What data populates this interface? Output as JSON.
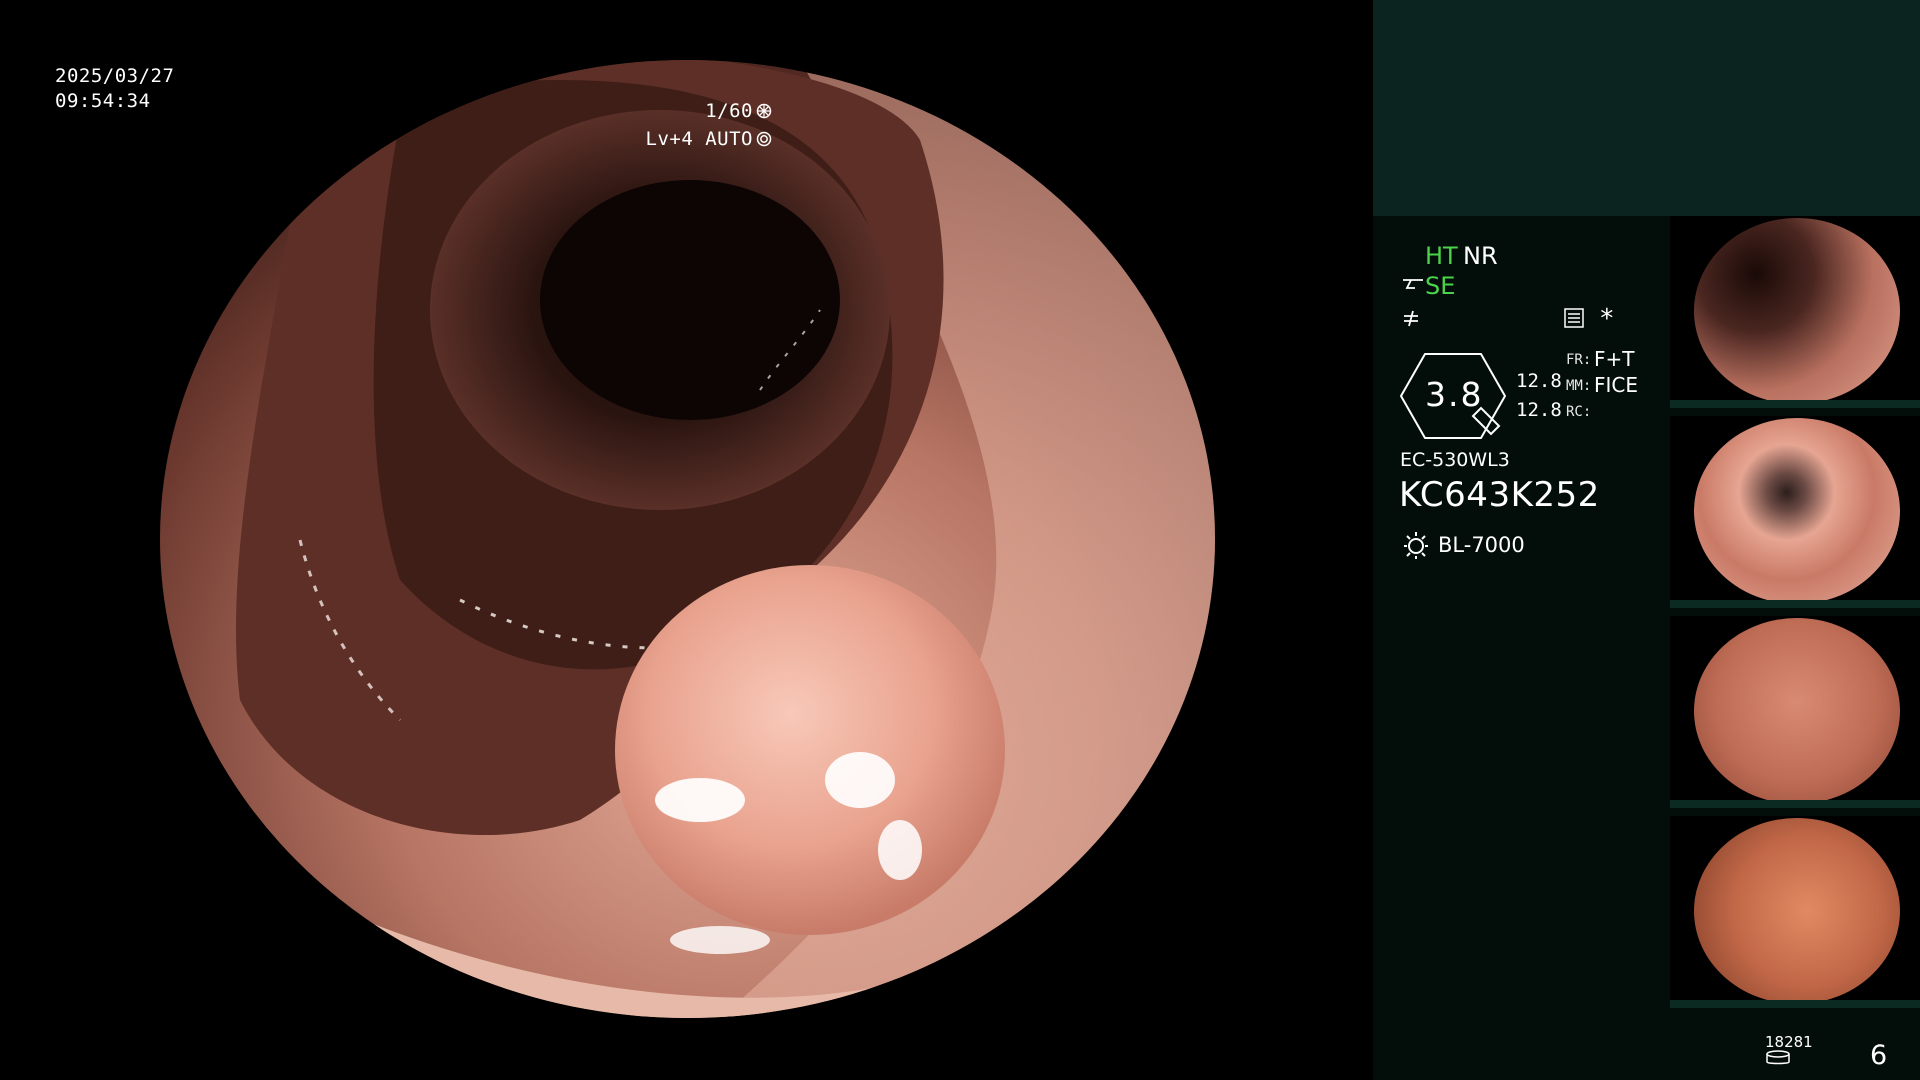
{
  "overlay": {
    "date": "2025/03/27",
    "time": "09:54:34",
    "shutter": "1/60",
    "iris": "Lv+4 AUTO"
  },
  "panel": {
    "ht_label": "HT",
    "nr_label": "NR",
    "se_label": "SE",
    "star": "*",
    "ring_value": "3.8",
    "value_1": "12.8",
    "value_2": "12.8",
    "fr_label": "FR:",
    "fr_value": "F+T",
    "mm_label": "MM:",
    "mm_value": "FICE",
    "rc_label": "RC:",
    "scope_model": "EC-530WL3",
    "scope_serial": "KC643K252",
    "light_source": "BL-7000",
    "image_count": "18281",
    "page_number": "6"
  },
  "colors": {
    "panel_top": "#0b2420",
    "panel_body": "#030e0b",
    "indicator_green": "#4bd34b"
  },
  "icons": [
    "shutter-gear-icon",
    "iris-icon",
    "structure-enhance-icon",
    "noise-icon",
    "menu-icon",
    "lamp-icon",
    "storage-icon",
    "zoom-indicator-icon"
  ]
}
